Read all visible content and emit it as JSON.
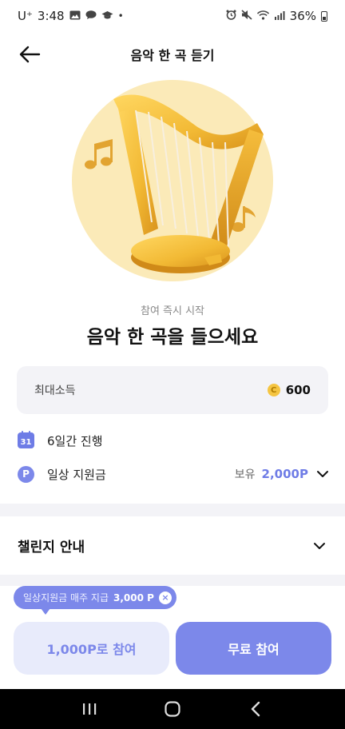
{
  "status_bar": {
    "carrier": "U⁺",
    "time": "3:48",
    "battery": "36%"
  },
  "header": {
    "title": "음악 한 곡 듣기"
  },
  "hero": {
    "image_icon": "harp-icon"
  },
  "intro": {
    "subtitle": "참여 즉시 시작",
    "headline": "음악 한 곡을 들으세요"
  },
  "reward": {
    "label": "최대소득",
    "coin_symbol": "C",
    "value": "600"
  },
  "info": {
    "calendar_day": "31",
    "duration": "6일간 진행",
    "point_symbol": "P",
    "support_label": "일상 지원금",
    "hold_label": "보유",
    "hold_value": "2,000P"
  },
  "guide": {
    "title": "챌린지 안내"
  },
  "tooltip": {
    "text": "일상지원금 매주 지급",
    "amount": "3,000 P",
    "close_symbol": "×"
  },
  "buttons": {
    "points_join": "1,000P로 참여",
    "free_join": "무료 참여"
  },
  "colors": {
    "accent": "#7c88ea",
    "accent_light": "#e8ebfb",
    "card_bg": "#f3f3f7",
    "hero_circle": "#fbeab8",
    "harp_gold": "#f2b934"
  }
}
